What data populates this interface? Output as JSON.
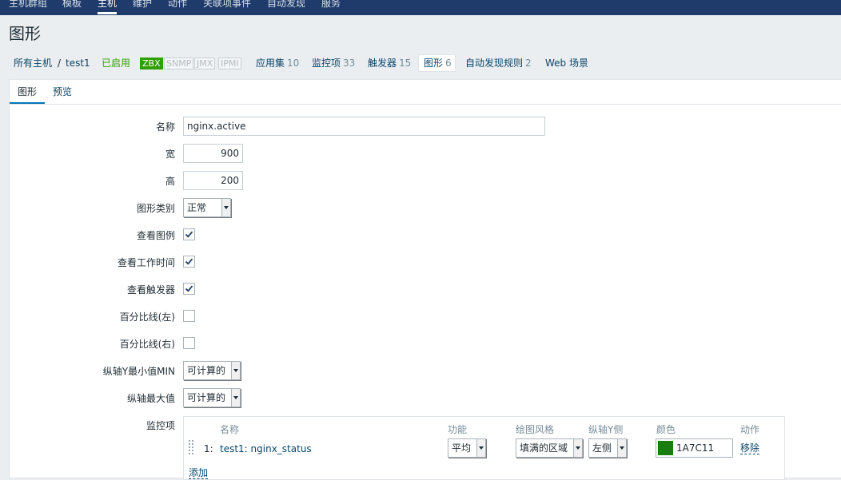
{
  "topnav": {
    "items": [
      "主机群组",
      "模板",
      "主机",
      "维护",
      "动作",
      "关联项事件",
      "自动发现",
      "服务"
    ],
    "active_index": 2
  },
  "page_title": "图形",
  "breadcrumb": {
    "all_hosts": "所有主机",
    "separator": "/",
    "host": "test1",
    "status": "已启用",
    "badges": [
      "ZBX",
      "SNMP",
      "JMX",
      "IPMI"
    ],
    "applications": {
      "label": "应用集",
      "count": "10"
    },
    "items": {
      "label": "监控项",
      "count": "33"
    },
    "triggers": {
      "label": "触发器",
      "count": "15"
    },
    "graphs": {
      "label": "图形",
      "count": "6"
    },
    "discovery": {
      "label": "自动发现规则",
      "count": "2"
    },
    "web": {
      "label": "Web 场景"
    }
  },
  "tabs": {
    "graph": "图形",
    "preview": "预览"
  },
  "form": {
    "name": {
      "label": "名称",
      "value": "nginx.active"
    },
    "width": {
      "label": "宽",
      "value": "900"
    },
    "height": {
      "label": "高",
      "value": "200"
    },
    "graph_type": {
      "label": "图形类别",
      "value": "正常"
    },
    "show_legend": {
      "label": "查看图例",
      "checked": true
    },
    "show_working_time": {
      "label": "查看工作时间",
      "checked": true
    },
    "show_triggers": {
      "label": "查看触发器",
      "checked": true
    },
    "percentile_left": {
      "label": "百分比线(左)",
      "checked": false
    },
    "percentile_right": {
      "label": "百分比线(右)",
      "checked": false
    },
    "y_min": {
      "label": "纵轴Y最小值MIN",
      "value": "可计算的"
    },
    "y_max": {
      "label": "纵轴最大值",
      "value": "可计算的"
    },
    "items_label": "监控项"
  },
  "items_table": {
    "headers": {
      "name": "名称",
      "function": "功能",
      "draw_style": "绘图风格",
      "y_axis": "纵轴Y侧",
      "color": "颜色",
      "action": "动作"
    },
    "rows": [
      {
        "num": "1:",
        "name": "test1: nginx_status",
        "function": "平均",
        "draw_style": "填满的区域",
        "y_axis": "左侧",
        "color": "1A7C11",
        "color_hex": "#1a7c11",
        "action": "移除"
      }
    ],
    "add_label": "添加"
  },
  "colors": {
    "nav_bg": "#1f3b6b",
    "link": "#0a466a",
    "enabled": "#2f9f00",
    "tab_active": "#0275b8"
  }
}
